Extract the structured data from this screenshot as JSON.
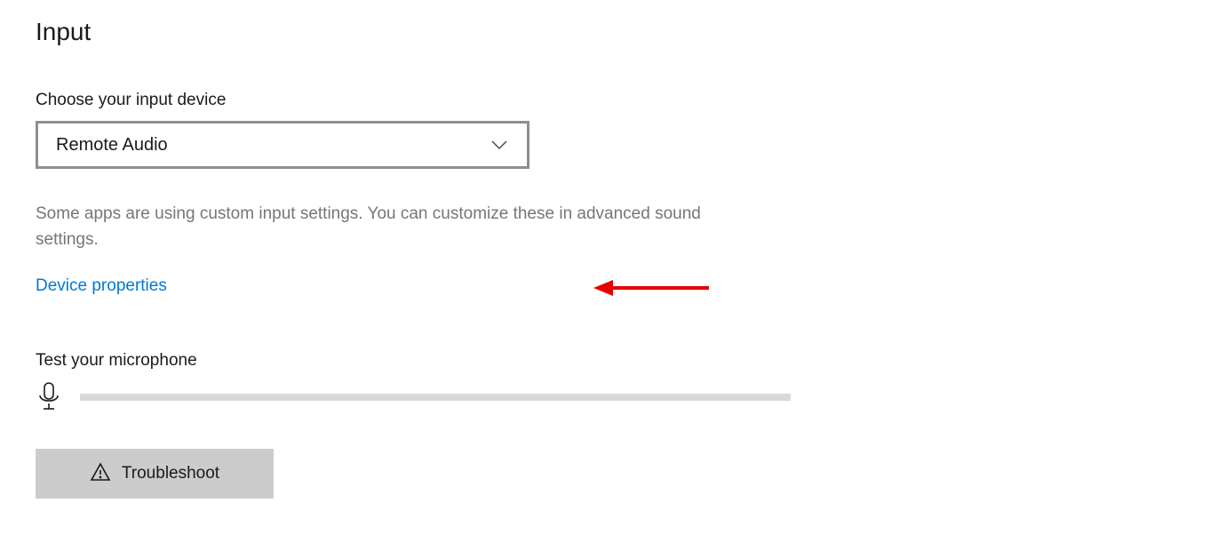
{
  "section": {
    "heading": "Input"
  },
  "input_device": {
    "label": "Choose your input device",
    "selected": "Remote Audio"
  },
  "helper_text": "Some apps are using custom input settings. You can customize these in advanced sound settings.",
  "link": {
    "device_properties": "Device properties"
  },
  "mic_test": {
    "label": "Test your microphone"
  },
  "troubleshoot": {
    "label": "Troubleshoot"
  },
  "annotation": {
    "arrow_color": "#e60000"
  }
}
